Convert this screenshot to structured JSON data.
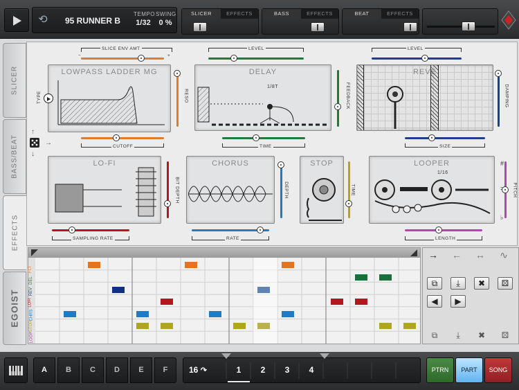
{
  "transport": {
    "song_name": "95 RUNNER B",
    "tempo_label": "TEMPO",
    "tempo_value": "1/32",
    "swing_label": "SWING",
    "swing_value": "0 %"
  },
  "sections": [
    {
      "label": "SLICER",
      "effects": "EFFECTS"
    },
    {
      "label": "BASS",
      "effects": "EFFECTS"
    },
    {
      "label": "BEAT",
      "effects": "EFFECTS"
    }
  ],
  "left_tabs": [
    "SLICER",
    "BASS/BEAT",
    "EFFECTS"
  ],
  "logo": "EGOIST",
  "effects": {
    "lowpass": {
      "title": "LOWPASS LADDER MG",
      "top": "SLICE ENV AMT",
      "bottom": "CUTOFF",
      "side": "RESO",
      "left": "TYPE",
      "minus": "−",
      "plus": "+"
    },
    "delay": {
      "title": "DELAY",
      "top": "LEVEL",
      "bottom": "TIME",
      "side": "FEEDBACK",
      "note": "1/8T"
    },
    "reverb": {
      "title": "REVE",
      "top": "LEVEL",
      "bottom": "SIZE",
      "side": "DAMPING"
    },
    "lofi": {
      "title": "LO-FI",
      "bottom": "SAMPLING RATE",
      "side": "BIT DEPTH"
    },
    "chorus": {
      "title": "CHORUS",
      "bottom": "RATE",
      "side": "DEPTH"
    },
    "stop": {
      "title": "STOP",
      "side": "TIME"
    },
    "looper": {
      "title": "LOOPER",
      "note": "1/16",
      "bottom": "LENGTH",
      "side": "PITCH",
      "sharp": "#",
      "eq": "=",
      "flat": "♭"
    }
  },
  "grid_rows": [
    "LOOP",
    "STOP",
    "CHRS",
    "LOFI",
    "REV",
    "DEL",
    "FLT"
  ],
  "colors": {
    "orange": "#e4731e",
    "green": "#1d6e3a",
    "navy": "#102e82",
    "red": "#b3161d",
    "blue": "#1f7bc6",
    "olive": "#aea61b",
    "slate": "#5f84b3",
    "khaki": "#b9b24c"
  },
  "pattern_buttons": [
    "A",
    "B",
    "C",
    "D",
    "E",
    "F"
  ],
  "steps": {
    "length": "16",
    "loop": "↷",
    "pages": [
      "1",
      "2",
      "3",
      "4"
    ]
  },
  "modes": {
    "ptrn": "PTRN",
    "part": "PART",
    "song": "SONG"
  },
  "icons": {
    "play": "play-icon",
    "keyboard": "keyboard-icon",
    "dice": "dice-icon",
    "copy": "copy-icon",
    "paste": "paste-icon",
    "clear": "clear-icon",
    "prev": "arrow-left-icon",
    "next": "arrow-right-icon"
  }
}
